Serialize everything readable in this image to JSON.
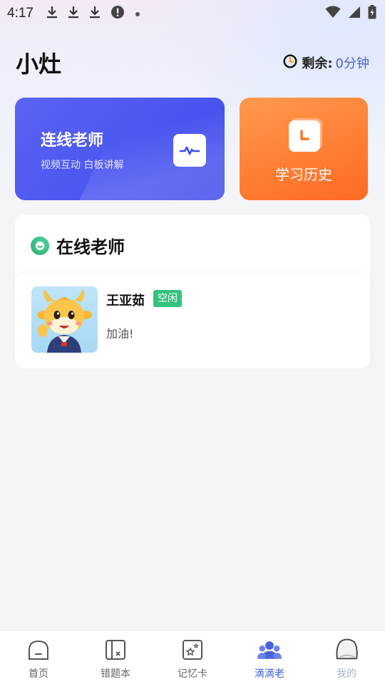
{
  "status_bar": {
    "time": "4:17",
    "icons": [
      "download-icon",
      "download-icon",
      "download-icon",
      "alert-icon",
      "dot-icon",
      "wifi-icon",
      "signal-icon",
      "battery-icon"
    ]
  },
  "header": {
    "title": "小灶",
    "remaining_label": "剩余:",
    "remaining_value": "0分钟"
  },
  "cards": {
    "connect": {
      "title": "连线老师",
      "subtitle": "视频互动 白板讲解",
      "icon": "waveform-icon"
    },
    "history": {
      "label": "学习历史",
      "icon": "clock-icon"
    }
  },
  "online": {
    "section_title": "在线老师",
    "teachers": [
      {
        "name": "王亚茹",
        "status": "空闲",
        "message": "加油!",
        "avatar": "cartoon-ox-avatar"
      }
    ]
  },
  "bottom_nav": {
    "items": [
      {
        "label": "首页",
        "icon": "home-icon"
      },
      {
        "label": "错题本",
        "icon": "wrong-book-icon"
      },
      {
        "label": "记忆卡",
        "icon": "memory-card-icon"
      },
      {
        "label": "滴滴老",
        "icon": "teachers-icon",
        "active": true
      },
      {
        "label": "我的",
        "icon": "profile-icon"
      }
    ]
  },
  "colors": {
    "accent": "#3d5bdc",
    "connect_card": "#4a55f0",
    "history_card": "#ff7d33",
    "status_idle": "#34c27f"
  }
}
